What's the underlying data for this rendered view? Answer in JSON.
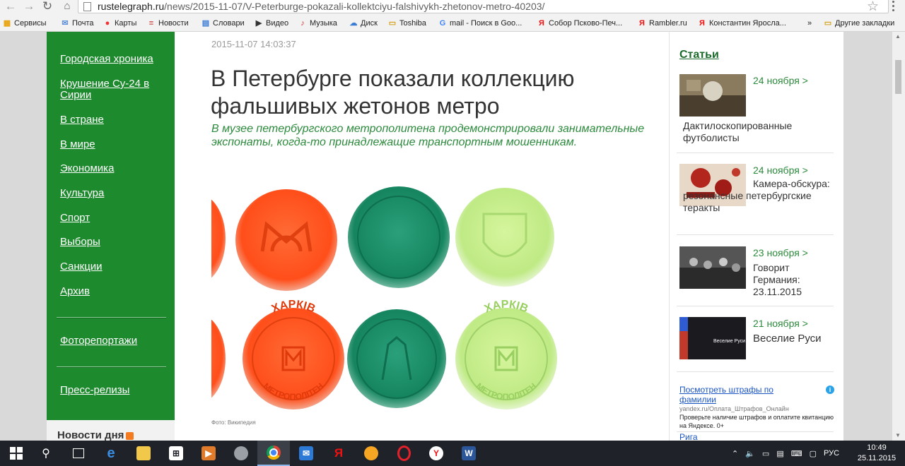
{
  "browser": {
    "url_host": "rustelegraph.ru",
    "url_path": "/news/2015-11-07/V-Peterburge-pokazali-kollektciyu-falshivykh-zhetonov-metro-40203/",
    "bookmarks": [
      "Сервисы",
      "Почта",
      "Карты",
      "Новости",
      "Словари",
      "Видео",
      "Музыка",
      "Диск",
      "Toshiba",
      "mail - Поиск в Goo...",
      "Собор Псково-Печ...",
      "Rambler.ru",
      "Константин Яросла..."
    ],
    "bookmarks_more": "»",
    "other_bookmarks": "Другие закладки"
  },
  "left_nav": {
    "links": [
      "Городская хроника",
      "Крушение Су-24 в Сирии",
      "В стране",
      "В мире",
      "Экономика",
      "Культура",
      "Спорт",
      "Выборы",
      "Санкции",
      "Архив"
    ],
    "photo_reports": "Фоторепортажи",
    "press_releases": "Пресс-релизы",
    "news_of_day": "Новости дня"
  },
  "article": {
    "date": "2015-11-07 14:03:37",
    "title": "В Петербурге показали коллекцию фальшивых жетонов метро",
    "lead": "В музее петербургского метрополитена продемонстрировали занимательные экспонаты, когда-то принадлежащие транспортным мошенникам.",
    "photo_caption": "Фото: Википедия",
    "token_texts": [
      "ХАРКІВ",
      "МЕТРОПОЛІТЕН"
    ]
  },
  "sidebar": {
    "title": "Статьи",
    "items": [
      {
        "date": "24 ноября >",
        "text": "Дактилоскопированные футболисты"
      },
      {
        "date": "24 ноября >",
        "text": "Камера-обскура: резонансные петербургские теракты"
      },
      {
        "date": "23 ноября >",
        "text": "Говорит Германия: 23.11.2015"
      },
      {
        "date": "21 ноября >",
        "text": "Веселие Руси",
        "thumb_caption": "Веселие Руси"
      }
    ],
    "ad": {
      "link": "Посмотреть штрафы по фамилии",
      "url": "yandex.ru/Оплата_Штрафов_Онлайн",
      "description": "Проверьте наличие штрафов и оплатите квитанцию на Яндексе. 0+",
      "next_link": "Рига"
    }
  },
  "taskbar": {
    "lang": "РУС",
    "time": "10:49",
    "date": "25.11.2015"
  },
  "colors": {
    "nav_green": "#1e8a2e",
    "lead_green": "#2c8a3c",
    "token_orange": "#ff5a22",
    "token_teal": "#1f9a72",
    "token_lime": "#c8f08a"
  }
}
